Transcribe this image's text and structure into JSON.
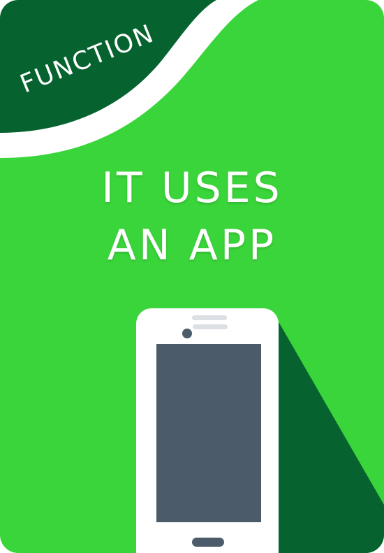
{
  "card": {
    "label": "FUNCTION",
    "headline_line1": "IT USES",
    "headline_line2": "AN APP",
    "icon": "smartphone-icon",
    "colors": {
      "background": "#3ad53a",
      "dark_green": "#06632f",
      "white": "#ffffff",
      "screen": "#4c5b69"
    }
  }
}
